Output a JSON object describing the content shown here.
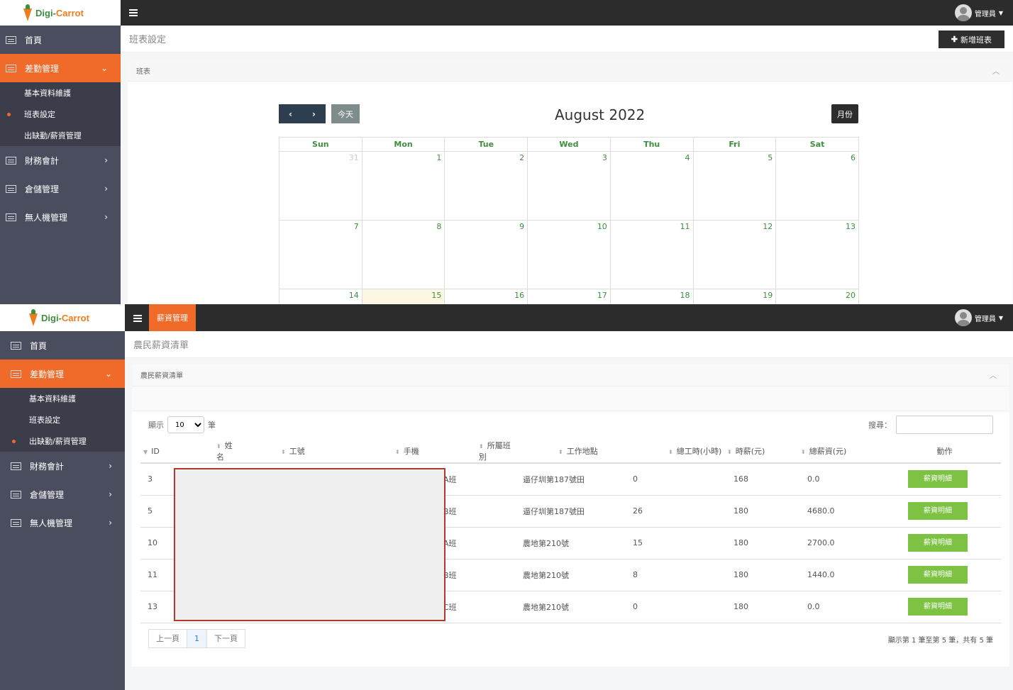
{
  "top": {
    "logo": {
      "part1": "Digi-",
      "part2": "Carrot"
    },
    "user": "管理員",
    "sidebar": {
      "home": "首頁",
      "attendance": "差勤管理",
      "attendance_items": [
        "基本資料維護",
        "班表設定",
        "出缺勤/薪資管理"
      ],
      "current_item": 1,
      "others": [
        "財務會計",
        "倉儲管理",
        "無人機管理"
      ]
    },
    "page_title": "班表設定",
    "add_button": "新增班表",
    "box_title": "班表",
    "calendar": {
      "title": "August 2022",
      "today_button": "今天",
      "month_button": "月份",
      "weekdays": [
        "Sun",
        "Mon",
        "Tue",
        "Wed",
        "Thu",
        "Fri",
        "Sat"
      ],
      "weeks": [
        [
          "31",
          "1",
          "2",
          "3",
          "4",
          "5",
          "6"
        ],
        [
          "7",
          "8",
          "9",
          "10",
          "11",
          "12",
          "13"
        ],
        [
          "14",
          "15",
          "16",
          "17",
          "18",
          "19",
          "20"
        ]
      ],
      "today": "15"
    }
  },
  "bottom": {
    "logo": {
      "part1": "Digi-",
      "part2": "Carrot"
    },
    "user": "管理員",
    "active_tab": "薪資管理",
    "sidebar": {
      "home": "首頁",
      "attendance": "差勤管理",
      "attendance_items": [
        "基本資料維護",
        "班表設定",
        "出缺勤/薪資管理"
      ],
      "current_item": 2,
      "others": [
        "財務會計",
        "倉儲管理",
        "無人機管理"
      ]
    },
    "page_title": "農民薪資清單",
    "box_title": "農民薪資清單",
    "length": {
      "prefix": "顯示",
      "value": "10",
      "suffix": "筆"
    },
    "search_label": "搜尋：",
    "columns": [
      "ID",
      "姓名",
      "工號",
      "手機",
      "所屬班別",
      "工作地點",
      "總工時(小時)",
      "時薪(元)",
      "總薪資(元)",
      "動作"
    ],
    "rows": [
      {
        "id": "3",
        "shift": "A班",
        "location": "逼仔圳第187號田",
        "hours": "0",
        "rate": "168",
        "total": "0.0",
        "action": "薪資明細"
      },
      {
        "id": "5",
        "shift": "B班",
        "location": "逼仔圳第187號田",
        "hours": "26",
        "rate": "180",
        "total": "4680.0",
        "action": "薪資明細"
      },
      {
        "id": "10",
        "shift": "A班",
        "location": "農地第210號",
        "hours": "15",
        "rate": "180",
        "total": "2700.0",
        "action": "薪資明細"
      },
      {
        "id": "11",
        "shift": "B班",
        "location": "農地第210號",
        "hours": "8",
        "rate": "180",
        "total": "1440.0",
        "action": "薪資明細"
      },
      {
        "id": "13",
        "shift": "C班",
        "location": "農地第210號",
        "hours": "0",
        "rate": "180",
        "total": "0.0",
        "action": "薪資明細"
      }
    ],
    "pager": {
      "prev": "上一頁",
      "page": "1",
      "next": "下一頁"
    },
    "info": "顯示第 1 筆至第 5 筆，共有 5 筆"
  }
}
